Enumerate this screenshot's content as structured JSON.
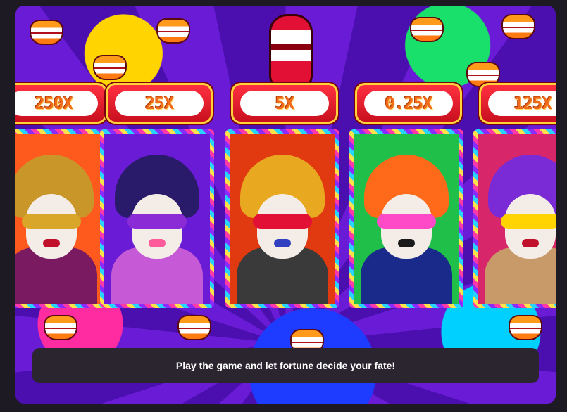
{
  "reels": [
    {
      "multiplier": "250X",
      "accent": "#d9a62a",
      "bg": "#ff5a1e"
    },
    {
      "multiplier": "25X",
      "accent": "#8a2bd6",
      "bg": "#6a1bd6"
    },
    {
      "multiplier": "5X",
      "accent": "#e8a820",
      "bg": "#e23a10"
    },
    {
      "multiplier": "0.25X",
      "accent": "#ff7a1a",
      "bg": "#1fbf4a"
    },
    {
      "multiplier": "125X",
      "accent": "#7a2bd6",
      "bg": "#d8266a"
    }
  ],
  "message": "Play the game and let fortune decide your fate!",
  "colors": {
    "background": "#1e1a24",
    "message_bar": "#2a252f",
    "plate": "#e21a2a",
    "multiplier_text": "#f26a1b"
  }
}
